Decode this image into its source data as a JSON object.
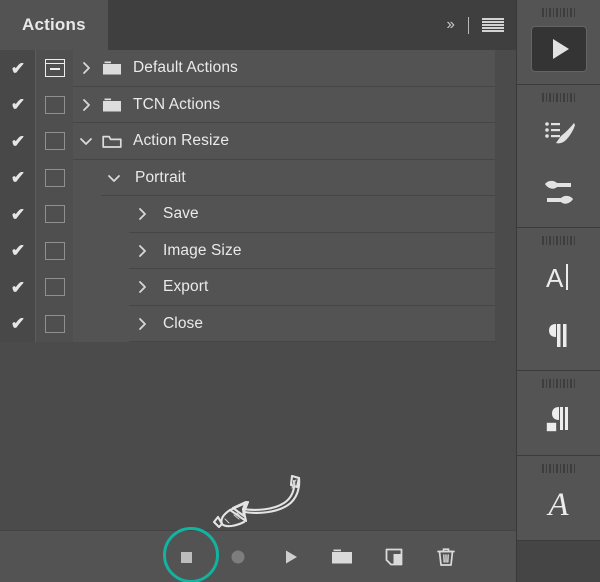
{
  "panel": {
    "tab_label": "Actions",
    "collapse_label": "››",
    "menu_icon": "hamburger-menu-icon",
    "columns": {
      "toggle_on": "✔"
    },
    "rows": [
      {
        "id": "default-actions",
        "label": "Default Actions",
        "checked": true,
        "check": "✔",
        "dialog_toggle": "modal",
        "indent": 0,
        "expanded": false,
        "folder": "closed",
        "has_folder": true
      },
      {
        "id": "tcn-actions",
        "label": "TCN Actions",
        "checked": true,
        "check": "✔",
        "dialog_toggle": "empty",
        "indent": 0,
        "expanded": false,
        "folder": "closed",
        "has_folder": true
      },
      {
        "id": "action-resize",
        "label": "Action Resize",
        "checked": true,
        "check": "✔",
        "dialog_toggle": "empty",
        "indent": 0,
        "expanded": true,
        "folder": "open",
        "has_folder": true
      },
      {
        "id": "portrait",
        "label": "Portrait",
        "checked": true,
        "check": "✔",
        "dialog_toggle": "empty",
        "indent": 1,
        "expanded": true,
        "folder": "none",
        "has_folder": false
      },
      {
        "id": "save",
        "label": "Save",
        "checked": true,
        "check": "✔",
        "dialog_toggle": "empty",
        "indent": 2,
        "expanded": false,
        "folder": "none",
        "has_folder": false
      },
      {
        "id": "image-size",
        "label": "Image Size",
        "checked": true,
        "check": "✔",
        "dialog_toggle": "empty",
        "indent": 2,
        "expanded": false,
        "folder": "none",
        "has_folder": false
      },
      {
        "id": "export",
        "label": "Export",
        "checked": true,
        "check": "✔",
        "dialog_toggle": "empty",
        "indent": 2,
        "expanded": false,
        "folder": "none",
        "has_folder": false
      },
      {
        "id": "close",
        "label": "Close",
        "checked": true,
        "check": "✔",
        "dialog_toggle": "empty",
        "indent": 2,
        "expanded": false,
        "folder": "none",
        "has_folder": false
      }
    ],
    "footer": {
      "buttons": [
        {
          "id": "stop",
          "icon": "stop-icon",
          "label": "Stop playing/recording",
          "enabled": true,
          "highlighted": true
        },
        {
          "id": "record",
          "icon": "record-icon",
          "label": "Begin recording",
          "enabled": false,
          "highlighted": false
        },
        {
          "id": "play",
          "icon": "play-icon",
          "label": "Play selection",
          "enabled": true,
          "highlighted": false
        },
        {
          "id": "new-set",
          "icon": "folder-icon",
          "label": "Create new set",
          "enabled": true,
          "highlighted": false
        },
        {
          "id": "new-action",
          "icon": "new-document-icon",
          "label": "Create new action",
          "enabled": true,
          "highlighted": false
        },
        {
          "id": "delete",
          "icon": "trash-icon",
          "label": "Delete",
          "enabled": true,
          "highlighted": false
        }
      ]
    }
  },
  "annotation": {
    "arrow_icon": "hand-drawn-curved-arrow",
    "highlight_icon": "teal-highlight-circle",
    "highlight_color": "#12b3a0",
    "points_to": "stop"
  },
  "dock": {
    "groups": [
      {
        "id": "play-group",
        "items": [
          {
            "id": "play-action",
            "icon": "play-icon",
            "label": "Play",
            "active": true
          }
        ]
      },
      {
        "id": "brush-group",
        "items": [
          {
            "id": "brushes",
            "icon": "brushes-icon",
            "label": "Brushes",
            "active": false
          },
          {
            "id": "brush-settings",
            "icon": "brush-settings-icon",
            "label": "Brush Settings",
            "active": false
          }
        ]
      },
      {
        "id": "type-group",
        "items": [
          {
            "id": "character",
            "icon": "character-icon",
            "label": "Character",
            "active": false
          },
          {
            "id": "paragraph",
            "icon": "paragraph-icon",
            "label": "Paragraph",
            "active": false
          }
        ]
      },
      {
        "id": "styles-group",
        "items": [
          {
            "id": "paragraph-styles",
            "icon": "paragraph-styles-icon",
            "label": "Paragraph Styles",
            "active": false
          }
        ]
      },
      {
        "id": "glyphs-group",
        "items": [
          {
            "id": "character-styles",
            "icon": "script-a-icon",
            "label": "Character Styles",
            "active": false,
            "glyph": "A"
          }
        ]
      }
    ]
  }
}
